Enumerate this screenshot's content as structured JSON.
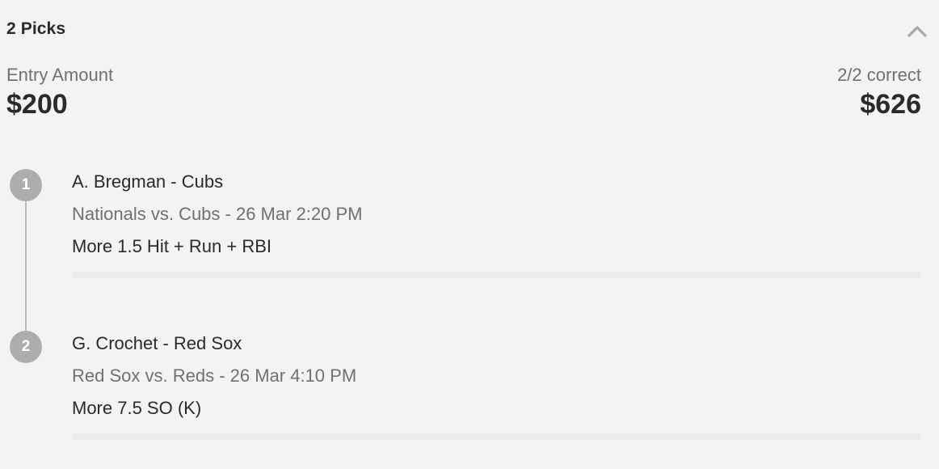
{
  "header": {
    "title": "2 Picks",
    "collapse_icon": "chevron-up-icon"
  },
  "summary": {
    "entry_label": "Entry Amount",
    "entry_value": "$200",
    "result_label": "2/2 correct",
    "result_value": "$626"
  },
  "picks": [
    {
      "number": "1",
      "player": "A. Bregman - Cubs",
      "game": "Nationals vs. Cubs - 26 Mar 2:20 PM",
      "stat": "More 1.5 Hit + Run + RBI"
    },
    {
      "number": "2",
      "player": "G. Crochet - Red Sox",
      "game": "Red Sox vs. Reds - 26 Mar 4:10 PM",
      "stat": "More 7.5 SO (K)"
    }
  ],
  "colors": {
    "background": "#f3f3f3",
    "step_circle": "#adadad",
    "timeline": "#b9b9b9",
    "text_primary": "#2a2a2a",
    "text_secondary": "#707070"
  }
}
